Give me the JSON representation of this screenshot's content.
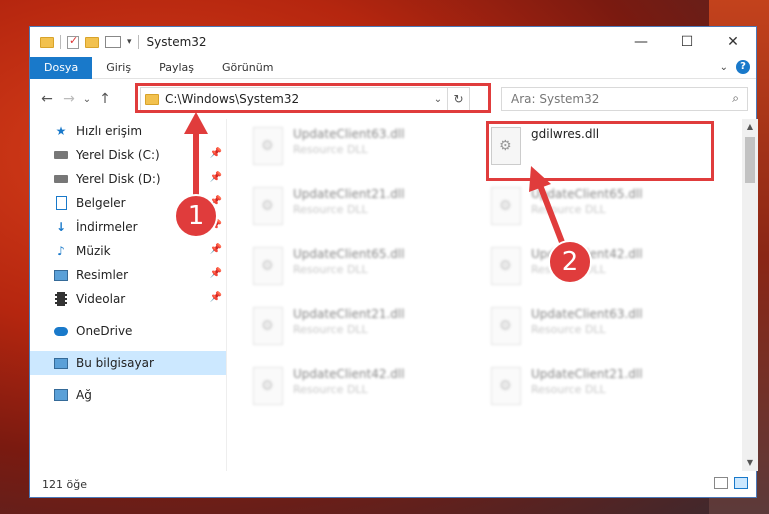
{
  "window": {
    "title": "System32",
    "controls": {
      "minimize": "—",
      "maximize": "☐",
      "close": "✕"
    }
  },
  "ribbon": {
    "tabs": [
      "Dosya",
      "Giriş",
      "Paylaş",
      "Görünüm"
    ],
    "active_tab": "Dosya",
    "help": "?"
  },
  "navigation": {
    "back": "←",
    "forward": "→",
    "recent": "⌄",
    "up": "↑",
    "address": "C:\\Windows\\System32",
    "search_placeholder": "Ara: System32"
  },
  "sidebar": {
    "items": [
      {
        "label": "Hızlı erişim",
        "icon": "star-icon"
      },
      {
        "label": "Yerel Disk (C:)",
        "icon": "disk-icon",
        "pinned": true
      },
      {
        "label": "Yerel Disk (D:)",
        "icon": "disk-icon",
        "pinned": true
      },
      {
        "label": "Belgeler",
        "icon": "document-icon",
        "pinned": true
      },
      {
        "label": "İndirmeler",
        "icon": "download-icon",
        "pinned": true
      },
      {
        "label": "Müzik",
        "icon": "music-icon",
        "pinned": true
      },
      {
        "label": "Resimler",
        "icon": "picture-icon",
        "pinned": true
      },
      {
        "label": "Videolar",
        "icon": "video-icon",
        "pinned": true
      },
      {
        "label": "OneDrive",
        "icon": "cloud-icon"
      },
      {
        "label": "Bu bilgisayar",
        "icon": "computer-icon",
        "selected": true
      },
      {
        "label": "Ağ",
        "icon": "network-icon"
      }
    ]
  },
  "files": [
    {
      "name": "UpdateClient63.dll",
      "type": "Resource DLL",
      "blurred": true
    },
    {
      "name": "gdilwres.dll",
      "type": "",
      "blurred": false
    },
    {
      "name": "UpdateClient21.dll",
      "type": "Resource DLL",
      "blurred": true
    },
    {
      "name": "UpdateClient65.dll",
      "type": "Resource DLL",
      "blurred": true
    },
    {
      "name": "UpdateClient65.dll",
      "type": "Resource DLL",
      "blurred": true
    },
    {
      "name": "UpdateClient42.dll",
      "type": "Resource DLL",
      "blurred": true
    },
    {
      "name": "UpdateClient21.dll",
      "type": "Resource DLL",
      "blurred": true
    },
    {
      "name": "UpdateClient63.dll",
      "type": "Resource DLL",
      "blurred": true
    },
    {
      "name": "UpdateClient42.dll",
      "type": "Resource DLL",
      "blurred": true
    },
    {
      "name": "UpdateClient21.dll",
      "type": "Resource DLL",
      "blurred": true
    }
  ],
  "status": {
    "count": "121 öğe"
  },
  "callouts": [
    "1",
    "2"
  ],
  "accent_color": "#1979ca",
  "highlight_color": "#e03c3c"
}
